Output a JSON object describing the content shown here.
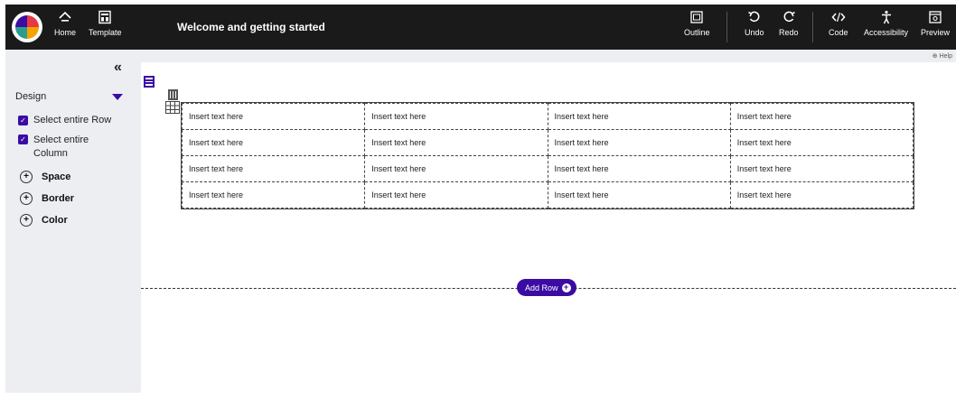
{
  "topbar": {
    "title": "Welcome and getting started",
    "left_buttons": [
      {
        "label": "Home",
        "icon": "home-icon"
      },
      {
        "label": "Template",
        "icon": "template-icon"
      }
    ],
    "right_buttons": [
      {
        "label": "Outline",
        "icon": "outline-icon"
      },
      {
        "label": "Undo",
        "icon": "undo-icon"
      },
      {
        "label": "Redo",
        "icon": "redo-icon"
      },
      {
        "label": "Code",
        "icon": "code-icon"
      },
      {
        "label": "Accessibility",
        "icon": "accessibility-icon"
      },
      {
        "label": "Preview",
        "icon": "preview-icon"
      }
    ]
  },
  "sidebar": {
    "collapse_glyph": "«",
    "design_label": "Design",
    "checkboxes": [
      {
        "label": "Select entire Row",
        "checked": true
      },
      {
        "label": "Select entire Column",
        "checked": true
      }
    ],
    "sections": [
      "Space",
      "Border",
      "Color"
    ]
  },
  "canvas": {
    "help_label": "Help",
    "table": {
      "rows": [
        [
          "Insert text here",
          "Insert text here",
          "Insert text here",
          "Insert text here"
        ],
        [
          "Insert text here",
          "Insert text here",
          "Insert text here",
          "Insert text here"
        ],
        [
          "Insert text here",
          "Insert text here",
          "Insert text here",
          "Insert text here"
        ],
        [
          "Insert text here",
          "Insert text here",
          "Insert text here",
          "Insert text here"
        ]
      ]
    },
    "add_row_label": "Add Row"
  },
  "colors": {
    "accent": "#3a0ca3",
    "topbar_bg": "#1a1a1a",
    "sidebar_bg": "#eceef1"
  }
}
